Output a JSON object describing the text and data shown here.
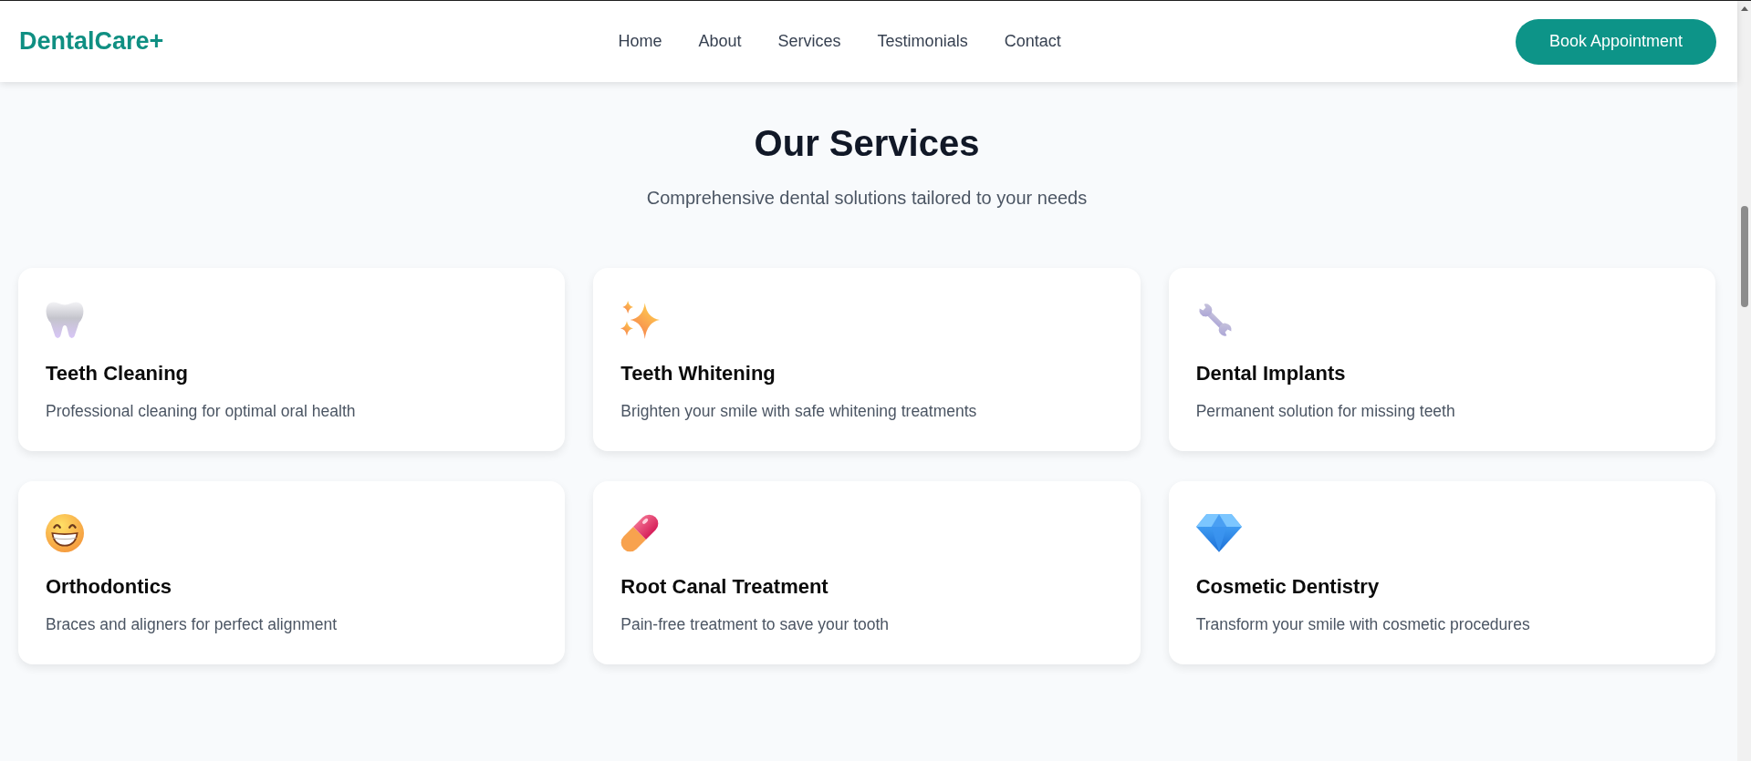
{
  "header": {
    "logo": "DentalCare+",
    "nav": [
      "Home",
      "About",
      "Services",
      "Testimonials",
      "Contact"
    ],
    "cta": "Book Appointment"
  },
  "services": {
    "title": "Our Services",
    "subtitle": "Comprehensive dental solutions tailored to your needs",
    "cards": [
      {
        "kind": "tooth",
        "title": "Teeth Cleaning",
        "description": "Professional cleaning for optimal oral health"
      },
      {
        "kind": "sparkles",
        "title": "Teeth Whitening",
        "description": "Brighten your smile with safe whitening treatments"
      },
      {
        "kind": "wrench",
        "title": "Dental Implants",
        "description": "Permanent solution for missing teeth"
      },
      {
        "kind": "grin",
        "title": "Orthodontics",
        "description": "Braces and aligners for perfect alignment"
      },
      {
        "kind": "pill",
        "title": "Root Canal Treatment",
        "description": "Pain-free treatment to save your tooth"
      },
      {
        "kind": "gem",
        "title": "Cosmetic Dentistry",
        "description": "Transform your smile with cosmetic procedures"
      }
    ]
  }
}
